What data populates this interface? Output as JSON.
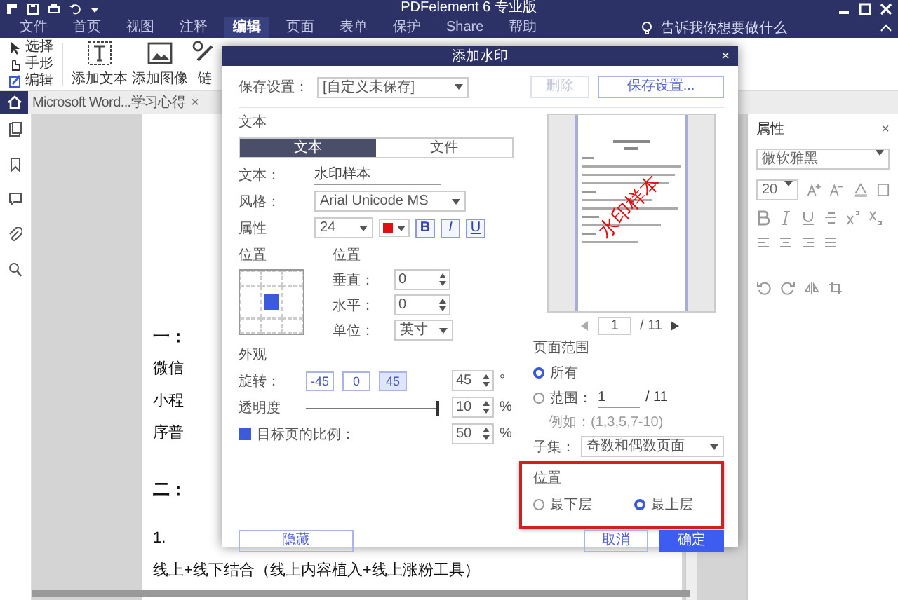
{
  "window": {
    "title": "PDFelement 6 专业版"
  },
  "menu": [
    {
      "label": "文件",
      "selected": false
    },
    {
      "label": "首页",
      "selected": false
    },
    {
      "label": "视图",
      "selected": false
    },
    {
      "label": "注释",
      "selected": false
    },
    {
      "label": "编辑",
      "selected": true
    },
    {
      "label": "页面",
      "selected": false
    },
    {
      "label": "表单",
      "selected": false
    },
    {
      "label": "保护",
      "selected": false
    },
    {
      "label": "Share",
      "selected": false
    },
    {
      "label": "帮助",
      "selected": false
    }
  ],
  "tell_me": "告诉我你想要做什么",
  "toolbar": {
    "modes": [
      {
        "label": "选择"
      },
      {
        "label": "手形"
      },
      {
        "label": "编辑"
      }
    ],
    "tools": [
      {
        "label": "添加文本"
      },
      {
        "label": "添加图像"
      },
      {
        "label": "链"
      }
    ]
  },
  "doc_tab": {
    "label": "Microsoft Word...学习心得",
    "close": "×"
  },
  "document": {
    "lines": [
      {
        "kind": "heading",
        "text": "一："
      },
      {
        "kind": "para",
        "text": "微信"
      },
      {
        "kind": "para",
        "text": "小程"
      },
      {
        "kind": "para",
        "text": "序普"
      },
      {
        "kind": "heading",
        "text": "二："
      },
      {
        "kind": "item",
        "text": "1."
      },
      {
        "kind": "para",
        "text": "线上+线下结合（线上内容植入+线上涨粉工具）"
      }
    ]
  },
  "dialog": {
    "title": "添加水印",
    "close": "×",
    "save_settings": {
      "label": "保存设置：",
      "value": "[自定义未保存]"
    },
    "delete_button": {
      "label": "删除",
      "disabled": true
    },
    "save_button": "保存设置...",
    "source": {
      "heading": "文本",
      "tabs": [
        {
          "label": "文本",
          "selected": true
        },
        {
          "label": "文件",
          "selected": false
        }
      ]
    },
    "text_field": {
      "label": "文本：",
      "value": "水印样本"
    },
    "style": {
      "label": "风格：",
      "value": "Arial Unicode MS"
    },
    "attributes": {
      "label": "属性",
      "size": "24",
      "color": "#e01010",
      "bold": "B",
      "italic": "I",
      "underline": "U"
    },
    "position": {
      "heading": "位置",
      "cells": [
        {
          "selected": false
        },
        {
          "selected": false
        },
        {
          "selected": false
        },
        {
          "selected": false
        },
        {
          "selected": true
        },
        {
          "selected": false
        },
        {
          "selected": false
        },
        {
          "selected": false
        },
        {
          "selected": false
        }
      ],
      "fields_heading": "位置",
      "vertical": {
        "label": "垂直：",
        "value": "0"
      },
      "horizontal": {
        "label": "水平：",
        "value": "0"
      },
      "unit": {
        "label": "单位：",
        "value": "英寸"
      }
    },
    "appearance": {
      "heading": "外观",
      "rotation": {
        "label": "旋转：",
        "presets": [
          {
            "label": "-45",
            "selected": false
          },
          {
            "label": "0",
            "selected": false
          },
          {
            "label": "45",
            "selected": true
          }
        ],
        "value": "45",
        "unit": "°"
      },
      "opacity": {
        "label": "透明度",
        "level": 1,
        "value": "10",
        "unit": "%"
      },
      "scale": {
        "label": "目标页的比例：",
        "checked": true,
        "value": "50",
        "unit": "%"
      }
    },
    "hide_button": "隐藏",
    "preview": {
      "watermark": "水印样本",
      "page": "1",
      "total": "/ 11"
    },
    "page_range": {
      "heading": "页面范围",
      "options": [
        {
          "label": "所有",
          "selected": true
        },
        {
          "label": "范围：",
          "selected": false
        }
      ],
      "from": "1",
      "to": "/ 11",
      "example": "例如：(1,3,5,7-10)",
      "subset": {
        "label": "子集：",
        "value": "奇数和偶数页面"
      }
    },
    "layer": {
      "heading": "位置",
      "options": [
        {
          "label": "最下层",
          "selected": false
        },
        {
          "label": "最上层",
          "selected": true
        }
      ]
    },
    "cancel_button": "取消",
    "ok_button": "确定"
  },
  "properties": {
    "title": "属性",
    "close": "×",
    "font": "微软雅黑",
    "size": "20"
  }
}
